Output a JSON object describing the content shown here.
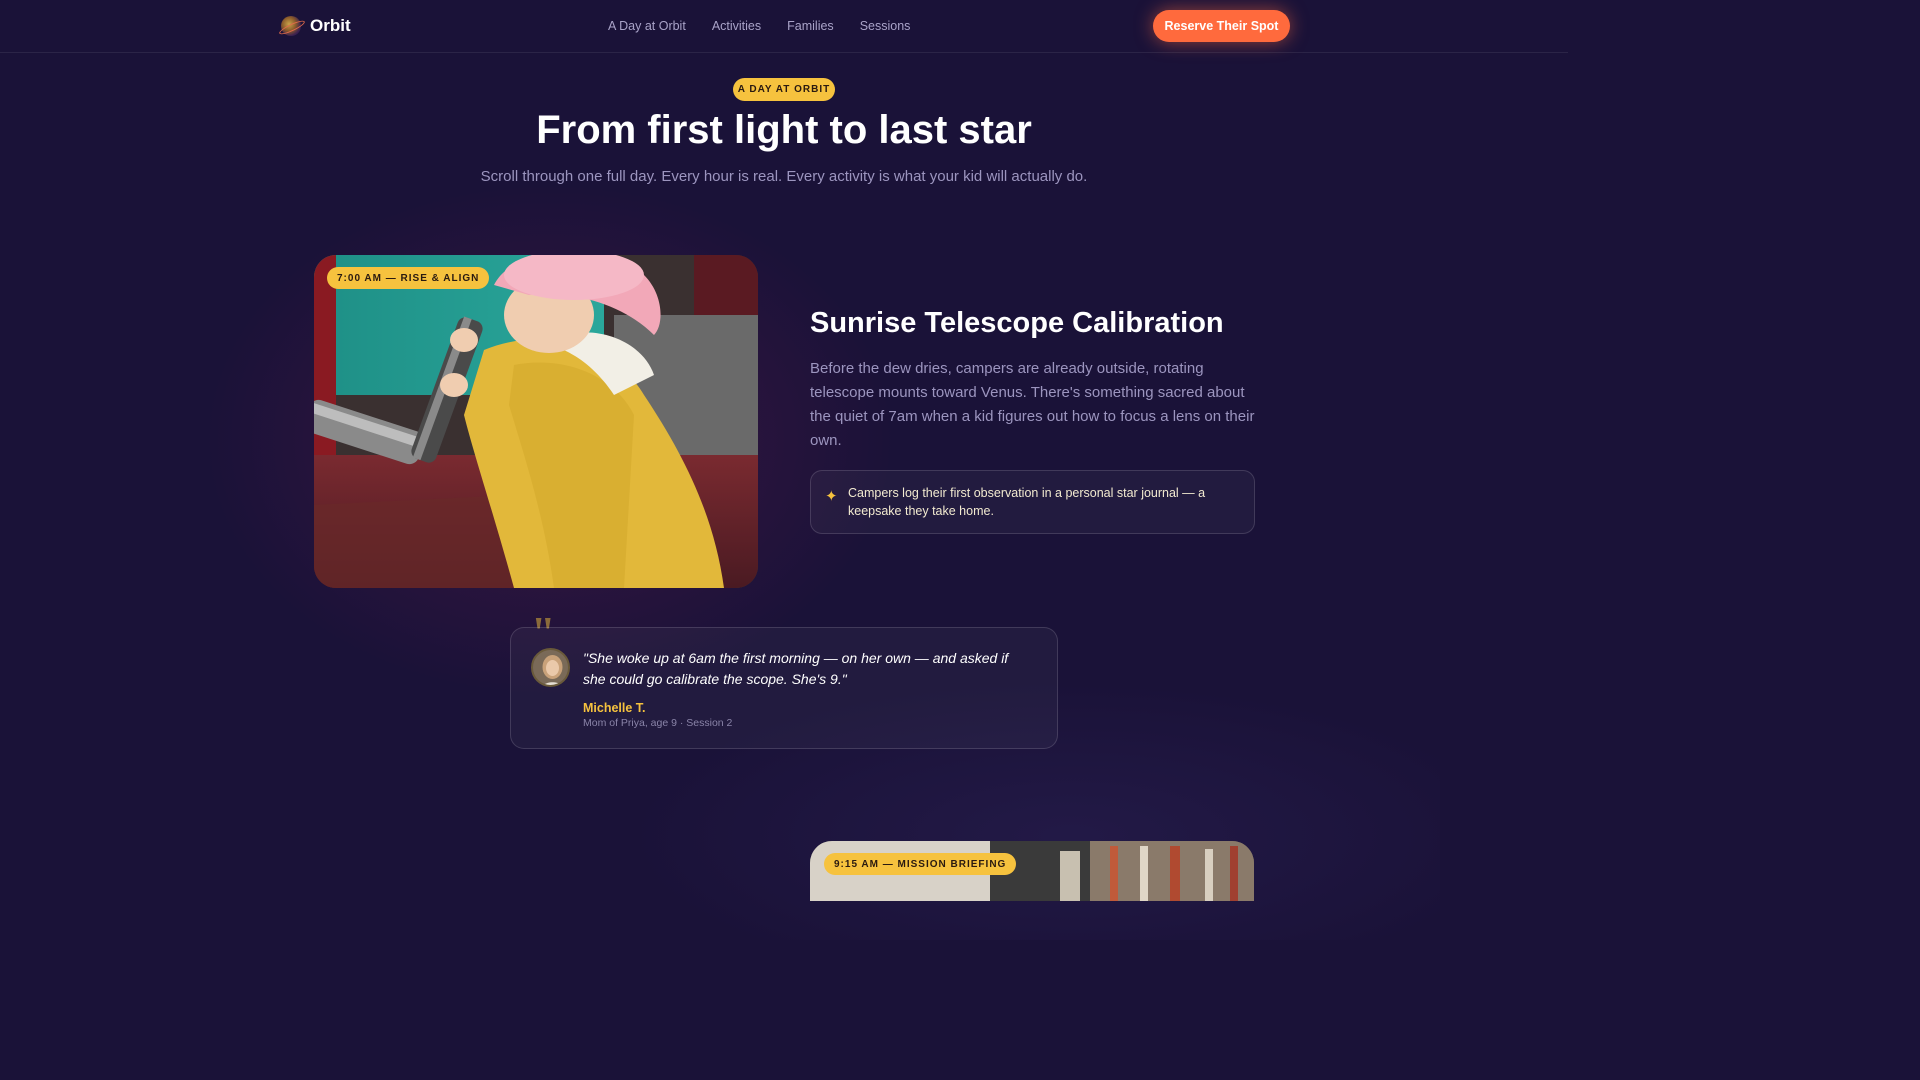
{
  "brand": {
    "name": "Orbit",
    "logo_icon": "planet-icon"
  },
  "nav": {
    "links": [
      "A Day at Orbit",
      "Activities",
      "Families",
      "Sessions"
    ],
    "cta": "Reserve Their Spot"
  },
  "hero": {
    "eyebrow": "A DAY AT ORBIT",
    "title": "From first light to last star",
    "subtitle": "Scroll through one full day. Every hour is real. Every activity is what your kid will actually do."
  },
  "activities": [
    {
      "time_badge": "7:00 AM — RISE & ALIGN",
      "image_icon": "child-with-telescope-photo",
      "title": "Sunrise Telescope Calibration",
      "description": "Before the dew dries, campers are already outside, rotating telescope mounts toward Venus. There's something sacred about the quiet of 7am when a kid figures out how to focus a lens on their own.",
      "note": {
        "icon": "sparkle-icon",
        "text": "Campers log their first observation in a personal star journal — a keepsake they take home."
      }
    },
    {
      "time_badge": "9:15 AM — MISSION BRIEFING",
      "image_icon": "workshop-photo"
    }
  ],
  "testimonial": {
    "quote_mark": "\"",
    "quote": "\"She woke up at 6am the first morning — on her own — and asked if she could go calibrate the scope. She's 9.\"",
    "name": "Michelle T.",
    "meta": "Mom of Priya, age 9 · Session 2"
  },
  "colors": {
    "background": "#1a1238",
    "accent_yellow": "#f6c23e",
    "cta_orange": "#ff6a3d",
    "muted_text": "#9c95bf"
  }
}
